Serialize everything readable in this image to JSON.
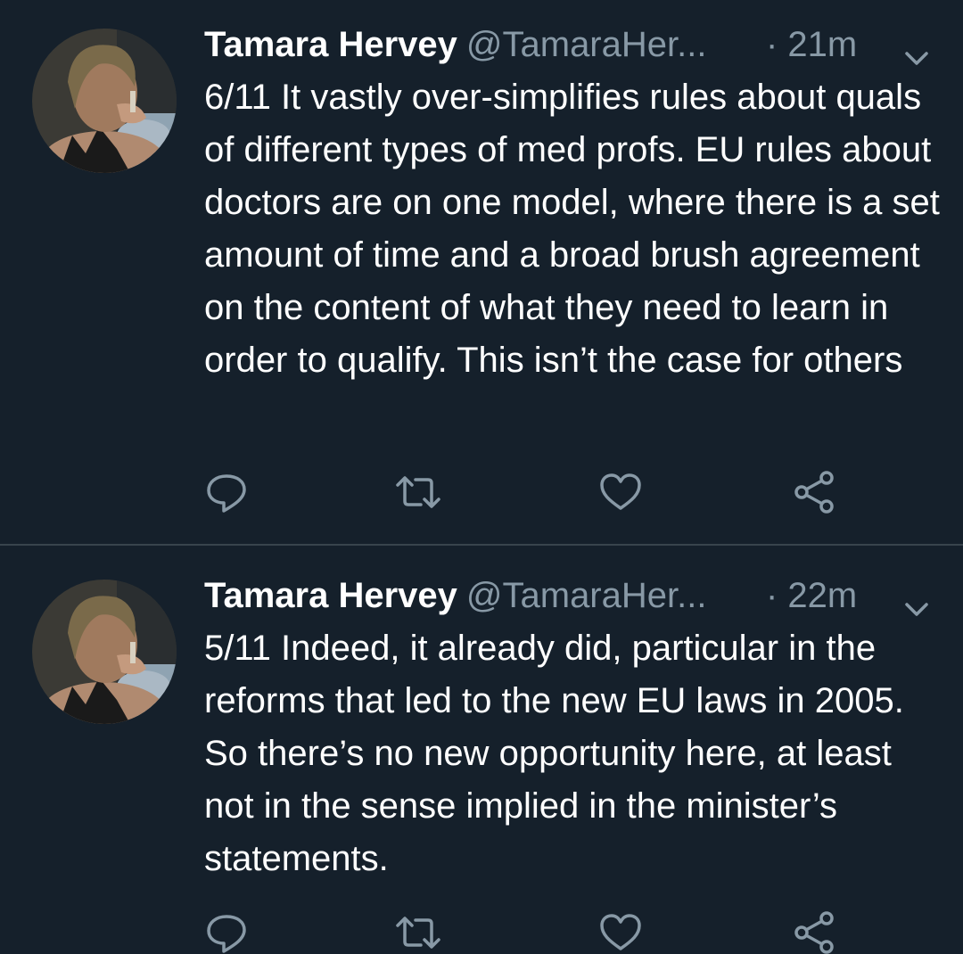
{
  "colors": {
    "background": "#15202b",
    "primary_text": "#ffffff",
    "secondary_text": "#8899a6",
    "divider": "#38444d"
  },
  "tweets": [
    {
      "author_name": "Tamara Hervey",
      "author_handle": "@TamaraHer...",
      "time": "· 21m",
      "text": "6/11 It vastly over-simplifies rules about quals of different types of med profs. EU rules about doctors are on one model, where there is a set amount of time and a broad brush agreement on the content of what they need to learn in order to qualify. This isn’t the case for others",
      "avatar_icon": "profile-photo",
      "actions": [
        "reply-icon",
        "retweet-icon",
        "like-icon",
        "share-icon"
      ]
    },
    {
      "author_name": "Tamara Hervey",
      "author_handle": "@TamaraHer...",
      "time": "· 22m",
      "text": "5/11 Indeed, it already did, particular in the reforms that led to the new EU laws in 2005. So there’s no new opportunity here, at least not in the sense implied in the minister’s statements.",
      "avatar_icon": "profile-photo",
      "actions": [
        "reply-icon",
        "retweet-icon",
        "like-icon",
        "share-icon"
      ]
    }
  ]
}
